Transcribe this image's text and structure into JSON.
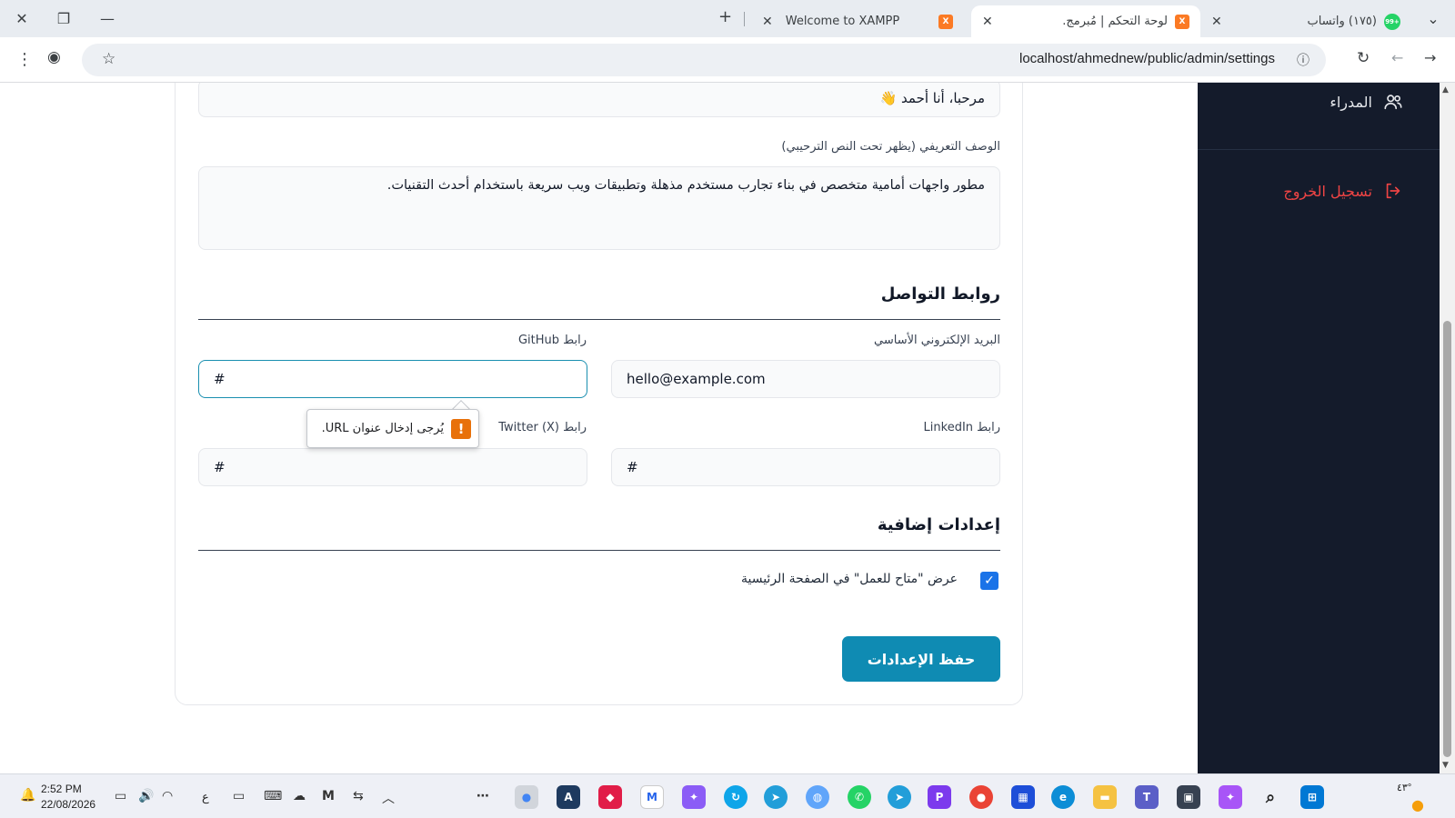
{
  "browser": {
    "tabs": [
      {
        "title": "(١٧٥) واتساب",
        "badge": "99+",
        "active": false
      },
      {
        "title": "لوحة التحكم | مُبرمج.",
        "active": true
      },
      {
        "title": "Welcome to XAMPP",
        "active": false
      }
    ],
    "url": "localhost/ahmednew/public/admin/settings",
    "new_tab": "+"
  },
  "form": {
    "hero_text_value": "مرحبا، أنا أحمد 👋",
    "description_label": "الوصف التعريفي (يظهر تحت النص الترحيبي)",
    "description_value": "مطور واجهات أمامية متخصص في بناء تجارب مستخدم مذهلة وتطبيقات ويب سريعة باستخدام أحدث التقنيات.",
    "contact_section_title": "روابط التواصل",
    "email_label": "البريد الإلكتروني الأساسي",
    "email_value": "hello@example.com",
    "github_label": "رابط GitHub",
    "github_value": "#",
    "linkedin_label": "رابط LinkedIn",
    "linkedin_value": "#",
    "twitter_label": "رابط Twitter (X)",
    "twitter_value": "#",
    "extra_section_title": "إعدادات إضافية",
    "available_label": "عرض \"متاح للعمل\" في الصفحة الرئيسية",
    "available_checked": true,
    "save_button": "حفظ الإعدادات"
  },
  "validation": {
    "message": "يُرجى إدخال عنوان URL."
  },
  "sidebar": {
    "items": [
      {
        "label": "المدراء",
        "icon": "users-icon"
      },
      {
        "label": "تسجيل الخروج",
        "icon": "logout-icon",
        "color": "#ef4444"
      }
    ]
  },
  "taskbar": {
    "time": "2:52 PM",
    "date": "22/08/2026",
    "lang": "ع",
    "weather": "٤٣°"
  },
  "colors": {
    "sidebar_bg": "#141b2b",
    "accent": "#0f8bb3",
    "logout": "#ef4444"
  }
}
